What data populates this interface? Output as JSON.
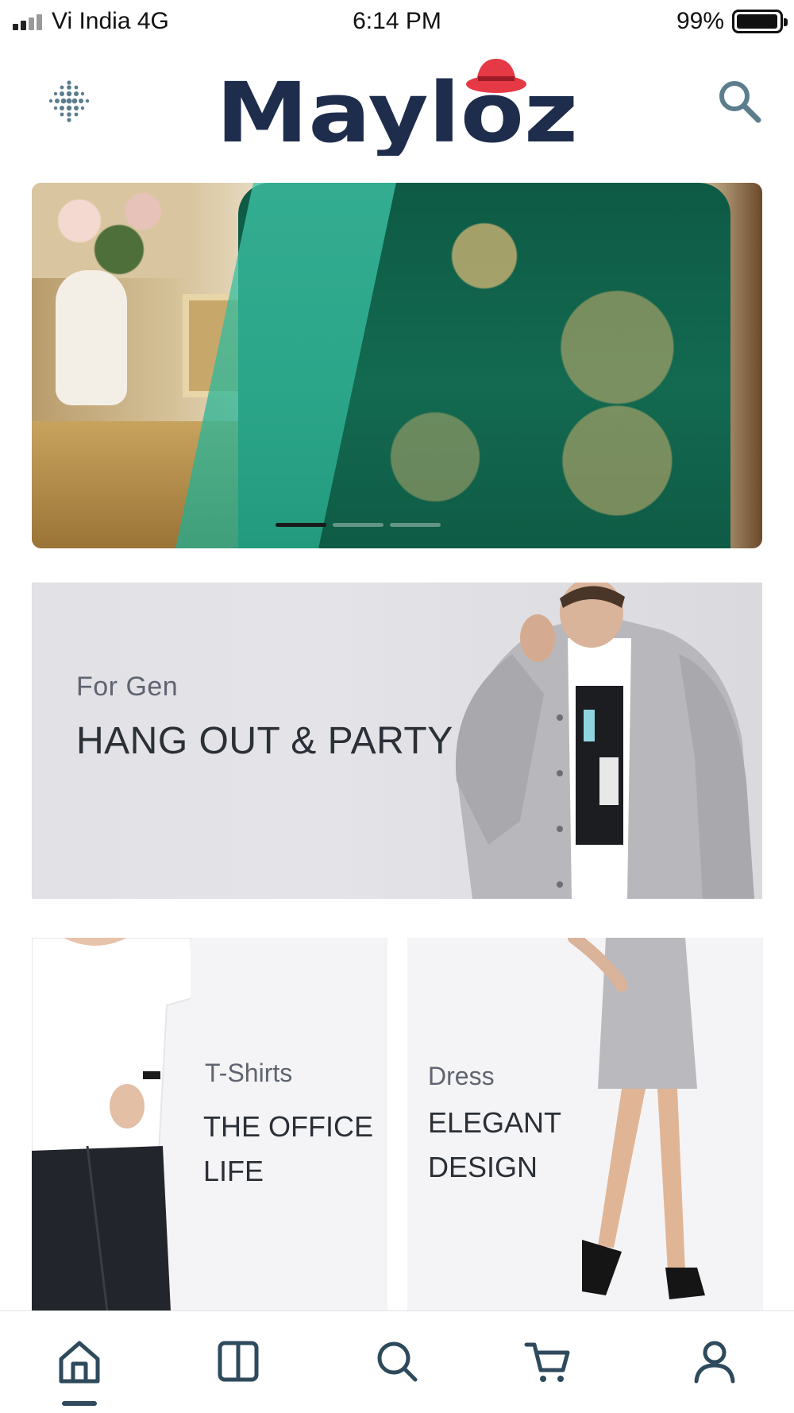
{
  "status_bar": {
    "carrier": "Vi India 4G",
    "time": "6:14 PM",
    "battery_percent": "99%",
    "signal_bars_filled": 2,
    "signal_bars_total": 4
  },
  "header": {
    "logo_text": "Mayloz",
    "menu_icon": "dot-grid-icon",
    "search_icon": "search-icon"
  },
  "hero": {
    "slide_count": 3,
    "active_slide": 1
  },
  "promo": {
    "subtitle": "For Gen",
    "title": "HANG OUT & PARTY"
  },
  "tiles": [
    {
      "subtitle": "T-Shirts",
      "title_line1": "THE OFFICE",
      "title_line2": "LIFE"
    },
    {
      "subtitle": "Dress",
      "title_line1": "ELEGANT",
      "title_line2": "DESIGN"
    }
  ],
  "bottom_nav": {
    "items": [
      "home-icon",
      "catalog-icon",
      "search-icon",
      "cart-icon",
      "profile-icon"
    ],
    "active": "home-icon"
  },
  "colors": {
    "brand_navy": "#1f2d4d",
    "brand_red": "#e53945",
    "nav_icon": "#2e4a5c",
    "text_dark": "#2b2f36",
    "text_muted": "#5f6470"
  }
}
